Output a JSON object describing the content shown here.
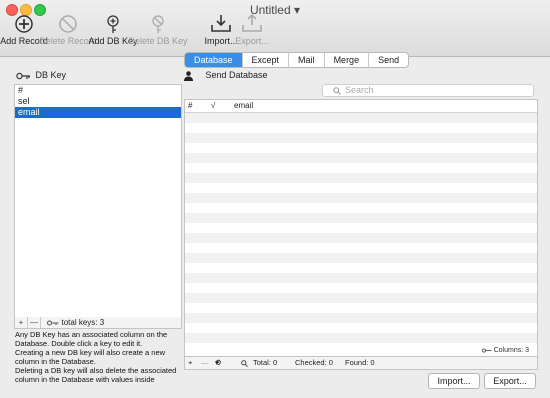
{
  "window": {
    "title": "Untitled"
  },
  "toolbar": {
    "add_record": "Add Record",
    "delete_record": "Delete Record",
    "add_db_key": "Add DB Key",
    "delete_db_key": "Delete DB Key",
    "import": "Import...",
    "export": "Export..."
  },
  "tabs": [
    "Database",
    "Except",
    "Mail",
    "Merge",
    "Send"
  ],
  "db_key_panel": {
    "title": "DB Key",
    "items": [
      "#",
      "sel",
      "email"
    ],
    "selected": "email",
    "add": "+",
    "remove": "—",
    "total_keys": "total keys: 3",
    "help": [
      "Any DB Key has an associated column on the Database. Double click a key to edit it.",
      "Creating a new DB key will also create a new column in the Database.",
      "Deleting a DB key will also delete the associated column in the Database with values inside"
    ]
  },
  "send_database": {
    "title": "Send Database",
    "search_placeholder": "Search",
    "columns": [
      "#",
      "√",
      "email"
    ],
    "columns_count": "Columns: 3",
    "footer": {
      "add": "+",
      "remove": "—",
      "gear": "⚙",
      "total": "Total: 0",
      "checked": "Checked: 0",
      "found": "Found: 0"
    },
    "import_button": "Import...",
    "export_button": "Export..."
  },
  "colors": {
    "accent": "#3a8ee6",
    "selection": "#1d69d6"
  }
}
